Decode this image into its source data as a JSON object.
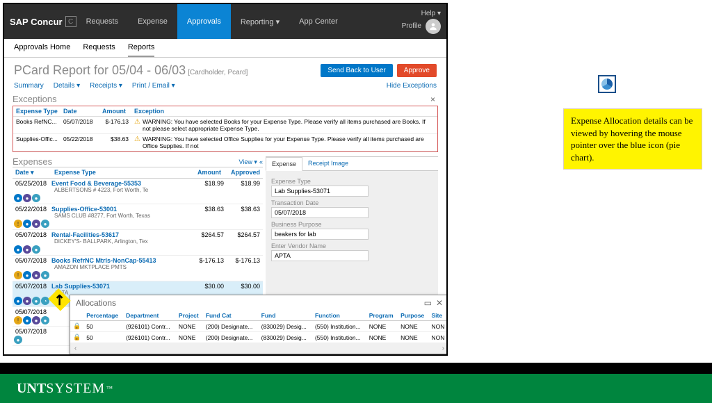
{
  "brand": "SAP Concur",
  "nav": {
    "items": [
      "Requests",
      "Expense",
      "Approvals",
      "Reporting ▾",
      "App Center"
    ],
    "active": 2
  },
  "help": "Help ▾",
  "profile": "Profile",
  "subnav": {
    "items": [
      "Approvals Home",
      "Requests",
      "Reports"
    ],
    "active": 2
  },
  "page": {
    "title": "PCard Report for 05/04 - 06/03",
    "subtitle": "[Cardholder, Pcard]"
  },
  "buttons": {
    "sendback": "Send Back to User",
    "approve": "Approve"
  },
  "tabs": {
    "summary": "Summary",
    "details": "Details ▾",
    "receipts": "Receipts ▾",
    "print": "Print / Email ▾",
    "hide": "Hide Exceptions"
  },
  "exceptions": {
    "title": "Exceptions",
    "headers": {
      "type": "Expense Type",
      "date": "Date",
      "amount": "Amount",
      "exc": "Exception"
    },
    "rows": [
      {
        "type": "Books RefNC...",
        "date": "05/07/2018",
        "amount": "$-176.13",
        "msg": "WARNING: You have selected Books for your Expense Type. Please verify all items purchased are Books. If not please select appropriate Expense Type."
      },
      {
        "type": "Supplies-Offic...",
        "date": "05/22/2018",
        "amount": "$38.63",
        "msg": "WARNING: You have selected Office Supplies for your Expense Type. Please verify all items purchased are Office Supplies. If not"
      }
    ]
  },
  "expenses": {
    "title": "Expenses",
    "view": "View ▾",
    "collapse": "«",
    "headers": {
      "date": "Date ▾",
      "type": "Expense Type",
      "amount": "Amount",
      "approved": "Approved"
    },
    "rows": [
      {
        "date": "05/25/2018",
        "name": "Event Food & Beverage-55353",
        "sub": "ALBERTSONS # 4223, Fort Worth, Te",
        "amount": "$18.99",
        "approved": "$18.99",
        "icons": [
          "blue",
          "purple",
          "teal"
        ]
      },
      {
        "date": "05/22/2018",
        "name": "Supplies-Office-53001",
        "sub": "SAMS CLUB #8277, Fort Worth, Texas",
        "amount": "$38.63",
        "approved": "$38.63",
        "icons": [
          "orange",
          "blue",
          "purple",
          "teal"
        ]
      },
      {
        "date": "05/07/2018",
        "name": "Rental-Facilities-53617",
        "sub": "DICKEY'S- BALLPARK, Arlington, Tex",
        "amount": "$264.57",
        "approved": "$264.57",
        "icons": [
          "blue",
          "purple",
          "teal"
        ]
      },
      {
        "date": "05/07/2018",
        "name": "Books RefrNC Mtrls-NonCap-55413",
        "sub": "AMAZON MKTPLACE PMTS",
        "amount": "$-176.13",
        "approved": "$-176.13",
        "icons": [
          "orange",
          "blue",
          "purple",
          "teal"
        ]
      },
      {
        "date": "05/07/2018",
        "name": "Lab Supplies-53071",
        "sub": "APTA",
        "amount": "$30.00",
        "approved": "$30.00",
        "icons": [
          "blue",
          "purple",
          "teal",
          "pie"
        ],
        "selected": true
      },
      {
        "date": "05/07/2018",
        "name": "",
        "sub": "",
        "amount": "",
        "approved": "",
        "icons": [
          "orange",
          "blue",
          "purple",
          "teal"
        ],
        "chev": true
      },
      {
        "date": "05/07/2018",
        "name": "",
        "sub": "",
        "amount": "",
        "approved": "",
        "icons": [
          "teal"
        ]
      }
    ]
  },
  "detail": {
    "tabs": {
      "expense": "Expense",
      "receipt": "Receipt Image"
    },
    "fields": {
      "type_label": "Expense Type",
      "type_val": "Lab Supplies-53071",
      "date_label": "Transaction Date",
      "date_val": "05/07/2018",
      "purpose_label": "Business Purpose",
      "purpose_val": "beakers for lab",
      "vendor_label": "Enter Vendor Name",
      "vendor_val": "APTA"
    }
  },
  "allocations": {
    "title": "Allocations",
    "headers": [
      "Percentage",
      "Department",
      "Project",
      "Fund Cat",
      "Fund",
      "Function",
      "Program",
      "Purpose",
      "Site"
    ],
    "rows": [
      {
        "pct": "50",
        "dept": "(926101) Contr...",
        "proj": "NONE",
        "fcat": "(200) Designate...",
        "fund": "(830029) Desig...",
        "func": "(550) Institution...",
        "prog": "NONE",
        "purp": "NONE",
        "site": "NON"
      },
      {
        "pct": "50",
        "dept": "(926101) Contr...",
        "proj": "NONE",
        "fcat": "(200) Designate...",
        "fund": "(830029) Desig...",
        "func": "(550) Institution...",
        "prog": "NONE",
        "purp": "NONE",
        "site": "NON"
      }
    ]
  },
  "note": "Expense Allocation details can be viewed by hovering the mouse pointer over the blue icon (pie chart).",
  "footer": {
    "bold": "UNT",
    "light": " SYSTEM"
  }
}
